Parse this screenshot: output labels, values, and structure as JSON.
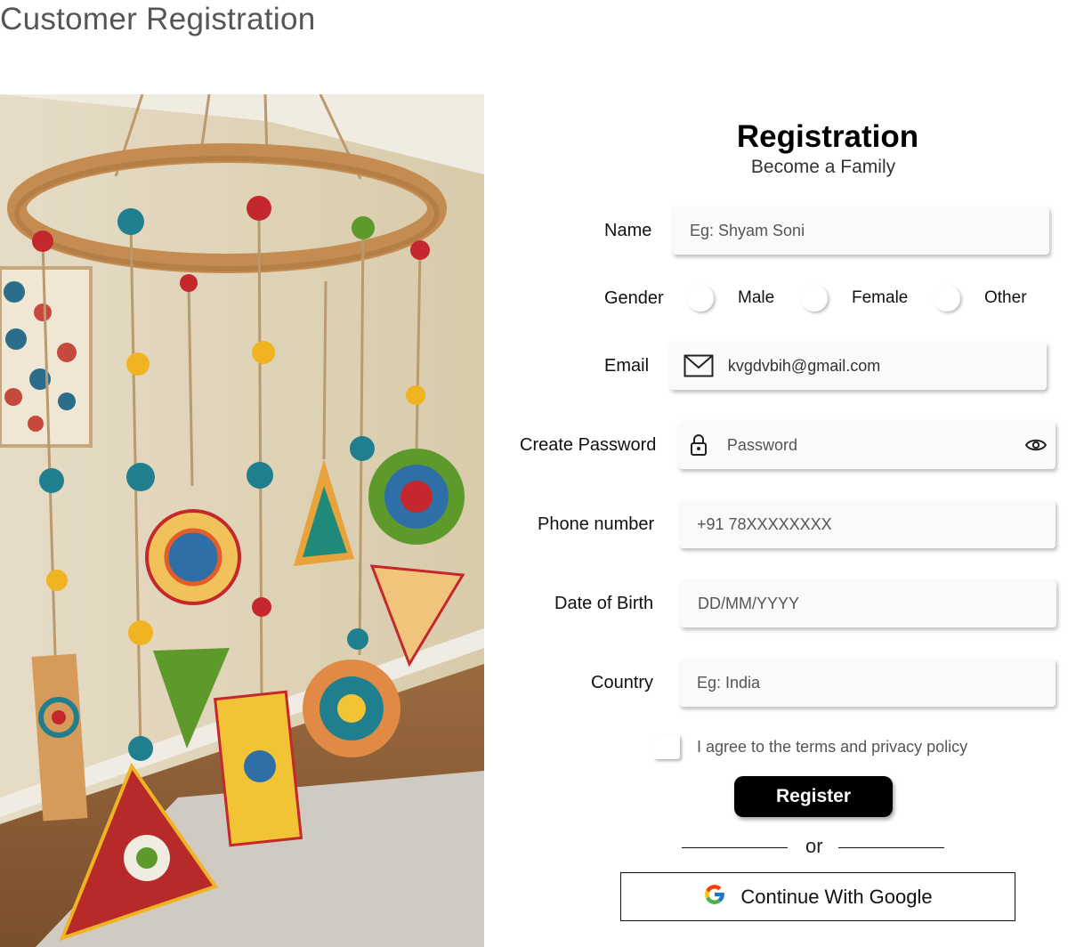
{
  "page": {
    "title": "Customer Registration"
  },
  "form": {
    "title": "Registration",
    "subtitle": "Become a Family",
    "name": {
      "label": "Name",
      "placeholder": "Eg: Shyam Soni"
    },
    "gender": {
      "label": "Gender",
      "options": [
        "Male",
        "Female",
        "Other"
      ]
    },
    "email": {
      "label": "Email",
      "value": "kvgdvbih@gmail.com",
      "icon": "mail-icon"
    },
    "password": {
      "label": "Create Password",
      "placeholder": "Password",
      "icon": "lock-icon",
      "toggle_icon": "eye-icon"
    },
    "phone": {
      "label": "Phone number",
      "placeholder": "+91 78XXXXXXXX"
    },
    "dob": {
      "label": "Date of Birth",
      "placeholder": "DD/MM/YYYY"
    },
    "country": {
      "label": "Country",
      "placeholder": "Eg: India"
    },
    "terms": {
      "label": "I agree to the terms and privacy policy",
      "checked": false
    },
    "register_label": "Register",
    "or_label": "or",
    "google_label": "Continue With Google"
  },
  "colors": {
    "primary_button": "#000000",
    "field_bg": "#fafafa",
    "page_bg": "#ffffff"
  }
}
